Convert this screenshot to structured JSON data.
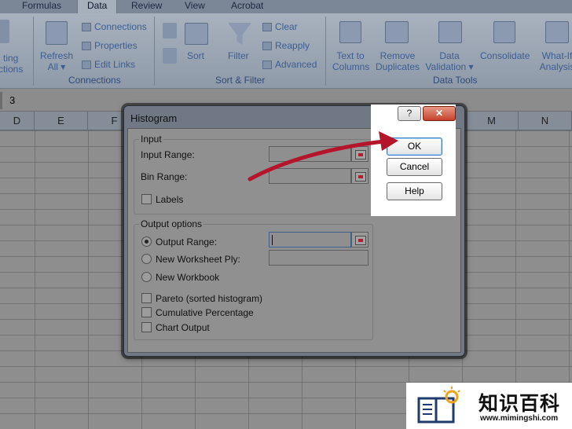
{
  "ribbon": {
    "tabs": [
      "Formulas",
      "Data",
      "Review",
      "View",
      "Acrobat"
    ],
    "active_tab": "Data",
    "partial_left": [
      "ting",
      "ctions"
    ],
    "refresh_all": [
      "Refresh",
      "All ▾"
    ],
    "connections_items": [
      "Connections",
      "Properties",
      "Edit Links"
    ],
    "connections_group": "Connections",
    "sort_label": "Sort",
    "filter_label": "Filter",
    "filter_items": [
      "Clear",
      "Reapply",
      "Advanced"
    ],
    "sort_filter_group": "Sort & Filter",
    "text_to_columns": [
      "Text to",
      "Columns"
    ],
    "remove_duplicates": [
      "Remove",
      "Duplicates"
    ],
    "data_validation": [
      "Data",
      "Validation ▾"
    ],
    "consolidate": "Consolidate",
    "what_if": [
      "What-If",
      "Analysis"
    ],
    "data_tools_group": "Data Tools"
  },
  "formula_bar": {
    "value": "3"
  },
  "grid": {
    "columns": [
      "D",
      "E",
      "F",
      "M",
      "N"
    ]
  },
  "dialog": {
    "title": "Histogram",
    "help_glyph": "?",
    "close_glyph": "✕",
    "input_section": "Input",
    "input_range_label": "Input Range:",
    "bin_range_label": "Bin Range:",
    "labels_label": "Labels",
    "output_section": "Output options",
    "output_range_label": "Output Range:",
    "new_ply_label": "New Worksheet Ply:",
    "new_workbook_label": "New Workbook",
    "pareto_label": "Pareto (sorted histogram)",
    "cumulative_label": "Cumulative Percentage",
    "chart_output_label": "Chart Output",
    "ok_label": "OK",
    "cancel_label": "Cancel",
    "help_label": "Help"
  },
  "watermark": {
    "text": "知识百科",
    "url": "www.mimingshi.com"
  },
  "colors": {
    "arrow": "#b5152b",
    "ok_border": "#3d7bc4"
  }
}
